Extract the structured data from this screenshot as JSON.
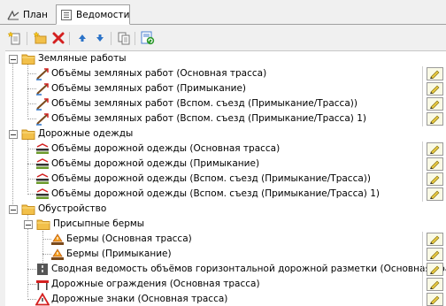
{
  "tabs": [
    {
      "label": "План",
      "icon": "plan-icon"
    },
    {
      "label": "Ведомости",
      "icon": "list-icon",
      "active": true
    }
  ],
  "toolbar": [
    {
      "name": "new-document-button",
      "icon": "document-star-icon"
    },
    {
      "name": "new-folder-button",
      "icon": "folder-star-icon"
    },
    {
      "name": "delete-button",
      "icon": "red-x-icon"
    },
    {
      "name": "move-up-button",
      "icon": "arrow-up-icon"
    },
    {
      "name": "move-down-button",
      "icon": "arrow-down-icon"
    },
    {
      "name": "copy-button",
      "icon": "copy-icon"
    },
    {
      "name": "refresh-button",
      "icon": "green-refresh-icon"
    }
  ],
  "tree": {
    "groups": [
      {
        "label": "Земляные работы",
        "items": [
          "Объёмы земляных работ (Основная трасса)",
          "Объёмы земляных работ (Примыкание)",
          "Объёмы земляных работ (Вспом. съезд (Примыкание/Трасса))",
          "Объёмы земляных работ (Вспом. съезд (Примыкание/Трасса) 1)"
        ]
      },
      {
        "label": "Дорожные одежды",
        "items": [
          "Объёмы дорожной одежды (Основная трасса)",
          "Объёмы дорожной одежды (Примыкание)",
          "Объёмы дорожной одежды (Вспом. съезд (Примыкание/Трасса))",
          "Объёмы дорожной одежды (Вспом. съезд (Примыкание/Трасса) 1)"
        ]
      },
      {
        "label": "Обустройство",
        "subgroup": {
          "label": "Присыпные бермы",
          "items": [
            "Бермы (Основная трасса)",
            "Бермы (Примыкание)"
          ]
        },
        "items": [
          "Сводная ведомость объёмов горизонтальной дорожной разметки (Основная трасса)",
          "Дорожные ограждения (Основная трасса)",
          "Дорожные знаки (Основная трасса)"
        ]
      }
    ]
  },
  "colors": {
    "folder": "#f2c04a",
    "accent_red": "#d42020",
    "toolbar_blue": "#2a72c8"
  }
}
